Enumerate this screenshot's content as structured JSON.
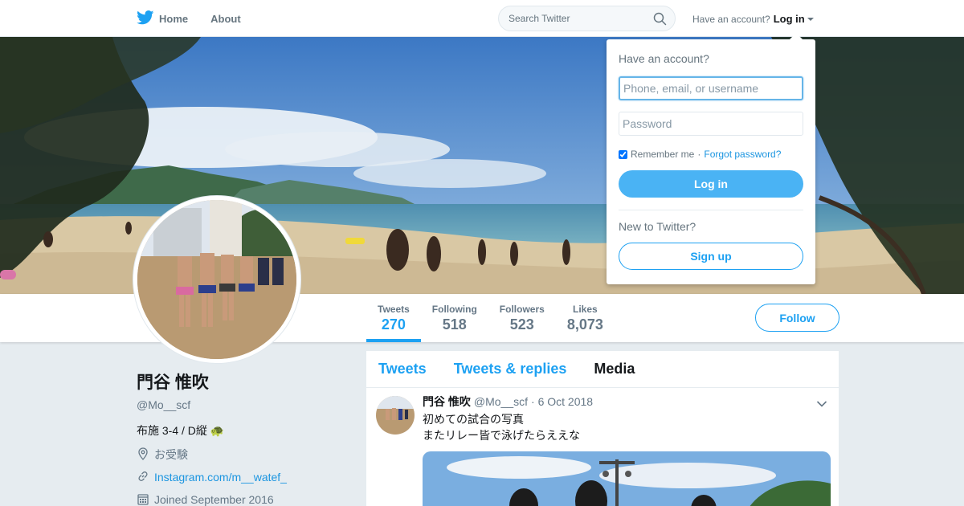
{
  "nav": {
    "home_label": "Home",
    "about_label": "About",
    "search_placeholder": "Search Twitter",
    "have_account": "Have an account?",
    "login_label": "Log in"
  },
  "login_dropdown": {
    "title": "Have an account?",
    "username_placeholder": "Phone, email, or username",
    "password_placeholder": "Password",
    "remember_label": "Remember me",
    "separator": "·",
    "forgot_label": "Forgot password?",
    "login_button": "Log in",
    "new_label": "New to Twitter?",
    "signup_button": "Sign up"
  },
  "stats": [
    {
      "label": "Tweets",
      "value": "270"
    },
    {
      "label": "Following",
      "value": "518"
    },
    {
      "label": "Followers",
      "value": "523"
    },
    {
      "label": "Likes",
      "value": "8,073"
    }
  ],
  "follow_label": "Follow",
  "profile": {
    "name": "門谷 惟吹",
    "handle": "@Mo__scf",
    "bio": "布施 3-4 / D縦 🐢",
    "location": "お受験",
    "link": "Instagram.com/m__watef_",
    "joined": "Joined September 2016"
  },
  "timeline_tabs": [
    "Tweets",
    "Tweets & replies",
    "Media"
  ],
  "tweet": {
    "name": "門谷 惟吹",
    "handle": "@Mo__scf",
    "date": "· 6 Oct 2018",
    "line1": "初めての試合の写真",
    "line2": "またリレー皆で泳げたらええな"
  },
  "colors": {
    "accent": "#1da1f2",
    "login_button": "#4ab3f4",
    "page_background": "#e6ecf0",
    "muted_text": "#657786"
  },
  "icons": {
    "brand": "twitter-bird-icon",
    "search": "search-icon",
    "location": "location-pin-icon",
    "link": "link-icon",
    "calendar": "calendar-icon",
    "chevron": "chevron-down-icon"
  }
}
